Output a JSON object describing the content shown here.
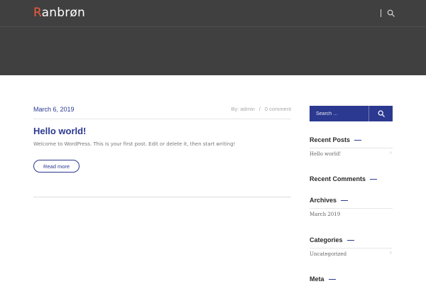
{
  "header": {
    "logo_first_letter": "R",
    "logo_rest": "anbrøn",
    "search_icon": "search-icon"
  },
  "post": {
    "date": "March 6, 2019",
    "author": "By: admin",
    "separator": "/",
    "comments": "0 comment",
    "title": "Hello world!",
    "excerpt": "Welcome to WordPress. This is your first post. Edit or delete it, then start writing!",
    "read_more": "Read more"
  },
  "sidebar": {
    "search_placeholder": "Search …",
    "recent_posts": {
      "title": "Recent Posts",
      "items": [
        "Hello world!"
      ]
    },
    "recent_comments": {
      "title": "Recent Comments"
    },
    "archives": {
      "title": "Archives",
      "items": [
        "March 2019"
      ]
    },
    "categories": {
      "title": "Categories",
      "items": [
        "Uncategorized"
      ]
    },
    "meta": {
      "title": "Meta"
    }
  },
  "colors": {
    "accent": "#2b3990",
    "logo_accent": "#ef5a3a",
    "header_bg": "#404040"
  }
}
